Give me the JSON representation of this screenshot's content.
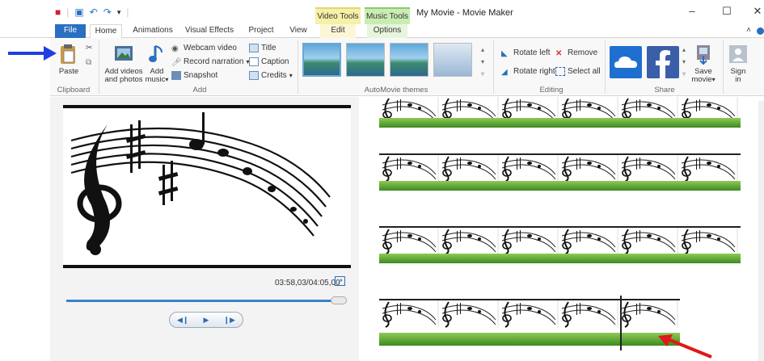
{
  "app": {
    "title": "My Movie - Movie Maker",
    "context_tabs": {
      "video_tools": "Video Tools",
      "music_tools": "Music Tools"
    }
  },
  "tabs": [
    "File",
    "Home",
    "Animations",
    "Visual Effects",
    "Project",
    "View",
    "Edit",
    "Options"
  ],
  "ribbon": {
    "clipboard": {
      "paste": "Paste",
      "group": "Clipboard"
    },
    "add": {
      "add_videos": "Add videos",
      "add_videos_2": "and photos",
      "add_music": "Add",
      "add_music_2": "music",
      "webcam": "Webcam video",
      "record": "Record narration",
      "snapshot": "Snapshot",
      "title": "Title",
      "caption": "Caption",
      "credits": "Credits",
      "group": "Add"
    },
    "themes": {
      "group": "AutoMovie themes"
    },
    "editing": {
      "rotate_left": "Rotate left",
      "rotate_right": "Rotate right",
      "remove": "Remove",
      "select_all": "Select all",
      "group": "Editing"
    },
    "share": {
      "save_movie": "Save",
      "save_movie_2": "movie",
      "group": "Share"
    },
    "sign_in": {
      "label": "Sign",
      "label_2": "in"
    }
  },
  "player": {
    "timecode": "03:58,03/04:05,00",
    "progress": 0.95
  },
  "colors": {
    "accent": "#2a6fc0",
    "annotation_blue": "#1e3fe0",
    "annotation_red": "#e01818",
    "audio_green": "#5aa830"
  }
}
